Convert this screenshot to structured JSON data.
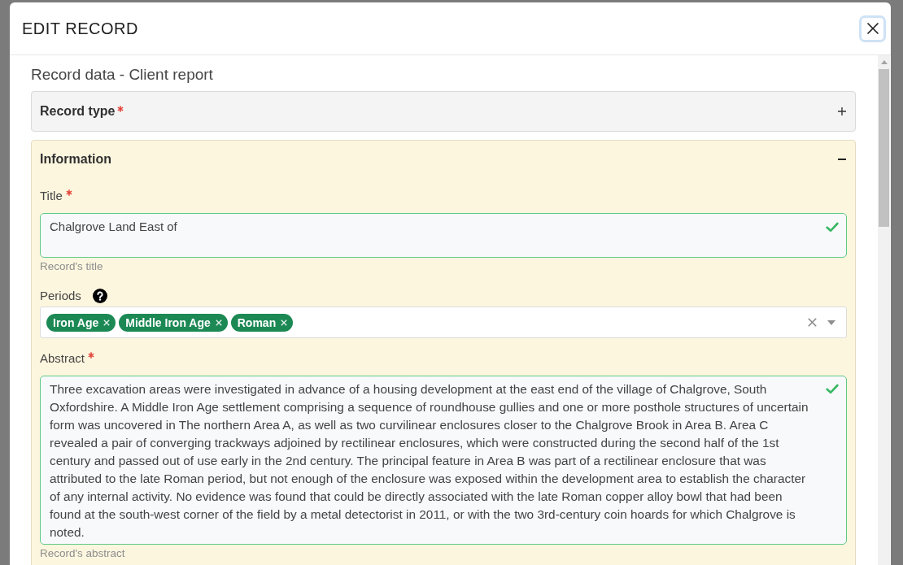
{
  "dialog": {
    "title": "EDIT RECORD",
    "close_button": {
      "focused": true
    }
  },
  "form": {
    "heading": "Record data - Client report",
    "sections": [
      {
        "title": "Record type",
        "required": true,
        "expanded": false
      },
      {
        "title": "Information",
        "required": false,
        "expanded": true,
        "fields": [
          {
            "kind": "text",
            "label": "Title",
            "required": true,
            "help_icon": false,
            "value": "Chalgrove Land East of",
            "validated": true,
            "help_text": "Record's title"
          },
          {
            "kind": "tags",
            "label": "Periods",
            "required": false,
            "help_icon": true,
            "tags": [
              {
                "label": "Iron Age"
              },
              {
                "label": "Middle Iron Age"
              },
              {
                "label": "Roman"
              }
            ],
            "validated": false
          },
          {
            "kind": "textarea",
            "label": "Abstract",
            "required": true,
            "help_icon": false,
            "value": "Three excavation areas were investigated in advance of a housing development at the east end of the village of Chalgrove, South Oxfordshire. A Middle Iron Age settlement comprising a sequence of roundhouse gullies and one or more posthole structures of uncertain form was uncovered in The northern Area A, as well as two curvilinear enclosures closer to the Chalgrove Brook in Area B. Area C revealed a pair of converging trackways adjoined by rectilinear enclosures, which were constructed during the second half of the 1st century and passed out of use early in the 2nd century. The principal feature in Area B was part of a rectilinear enclosure that was attributed to the late Roman period, but not enough of the enclosure was exposed within the development area to establish the character of any internal activity. No evidence was found that could be directly associated with the late Roman copper alloy bowl that had been found at the south-west corner of the field by a metal detectorist in 2011, or with the two 3rd-century coin hoards for which Chalgrove is noted.",
            "validated": true,
            "help_text": "Record's abstract"
          }
        ]
      }
    ]
  }
}
